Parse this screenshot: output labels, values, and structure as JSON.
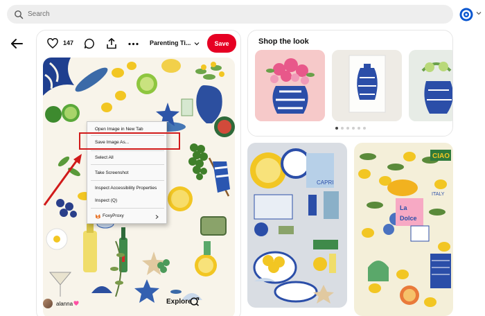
{
  "search": {
    "placeholder": "Search"
  },
  "pin": {
    "like_count": "147",
    "board_name": "Parenting Ti...",
    "save_label": "Save",
    "explore_label": "Explore",
    "author": "alanna"
  },
  "context_menu": {
    "items": [
      "Open Image in New Tab",
      "Save Image As...",
      "Select All",
      "Take Screenshot",
      "Inspect Accessibility Properties",
      "Inspect (Q)",
      "FoxyProxy"
    ]
  },
  "shop": {
    "title": "Shop the look",
    "dot_count": 6,
    "active_dot": 0
  },
  "colors": {
    "save_red": "#e60023",
    "highlight_red": "#d11a1a",
    "accent_blue": "#0b57d0"
  }
}
